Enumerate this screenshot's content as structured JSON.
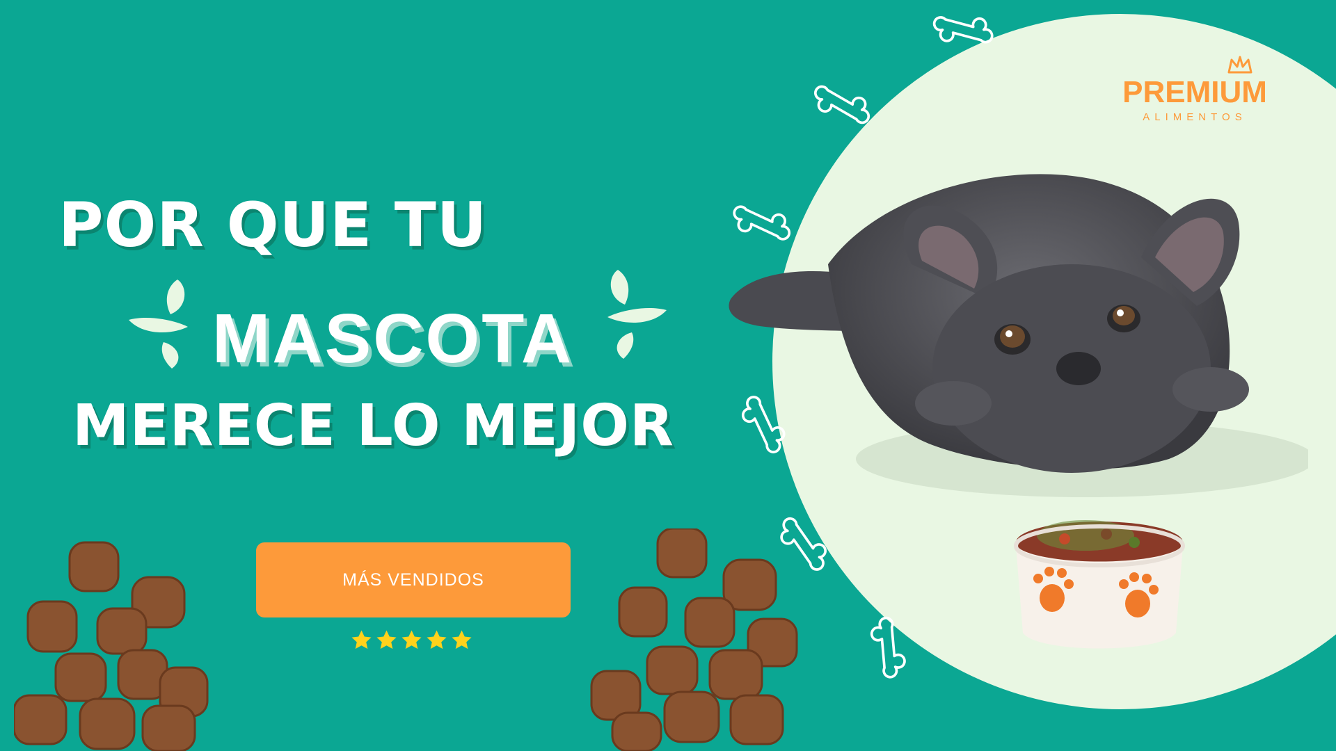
{
  "colors": {
    "background": "#0ba793",
    "circle": "#e9f7e3",
    "accent_orange": "#fd9a3a",
    "headline_text": "#ffffff",
    "splash": "#e9f7e3",
    "star": "#ffd21c",
    "kibble_dark": "#7a4a2a",
    "kibble_light": "#a86a3c",
    "dog": "#4a4a4e",
    "bone_stroke": "#ffffff"
  },
  "headline": {
    "line1": "POR QUE TU",
    "line2": "MASCOTA",
    "line3": "MERECE LO MEJOR"
  },
  "cta": {
    "label": "MÁS VENDIDOS"
  },
  "rating": {
    "stars": 5
  },
  "logo": {
    "name": "PREMIUM",
    "subtitle": "ALIMENTOS"
  },
  "icons": [
    "bone-icon",
    "crown-icon",
    "star-icon",
    "splash-icon"
  ]
}
